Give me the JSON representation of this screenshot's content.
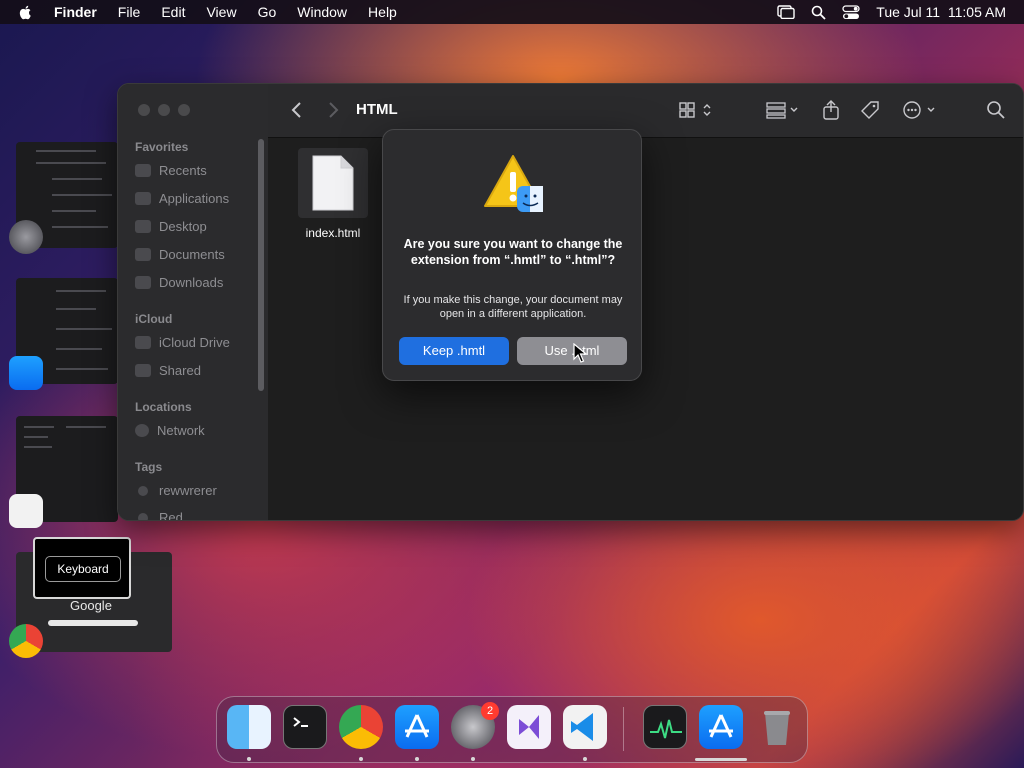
{
  "menubar": {
    "app_name": "Finder",
    "menus": [
      "File",
      "Edit",
      "View",
      "Go",
      "Window",
      "Help"
    ],
    "datetime": "Tue Jul 11  11:05 AM"
  },
  "finder": {
    "folder_title": "HTML",
    "sidebar": {
      "favorites_header": "Favorites",
      "favorites": [
        "Recents",
        "Applications",
        "Desktop",
        "Documents",
        "Downloads"
      ],
      "icloud_header": "iCloud",
      "icloud": [
        "iCloud Drive",
        "Shared"
      ],
      "locations_header": "Locations",
      "locations": [
        "Network"
      ],
      "tags_header": "Tags",
      "tags": [
        "rewwrerer",
        "Red"
      ]
    },
    "file": {
      "name": "index.html"
    }
  },
  "dialog": {
    "message": "Are you sure you want to change the extension from “.hmtl” to “.html”?",
    "detail": "If you make this change, your document may open in a different application.",
    "keep_button": "Keep .hmtl",
    "use_button": "Use .html"
  },
  "keyboard_tooltip": "Keyboard",
  "switcher": {
    "google_label": "Google"
  },
  "dock": {
    "apps": [
      "finder",
      "terminal",
      "chrome",
      "app-store",
      "system-settings",
      "visual-studio",
      "vscode",
      "activity-monitor",
      "app-store-2",
      "trash"
    ],
    "settings_badge": "2"
  },
  "colors": {
    "accent": "#1f6fe0",
    "secondary_button": "#8e8e93",
    "badge": "#ff3b30"
  }
}
